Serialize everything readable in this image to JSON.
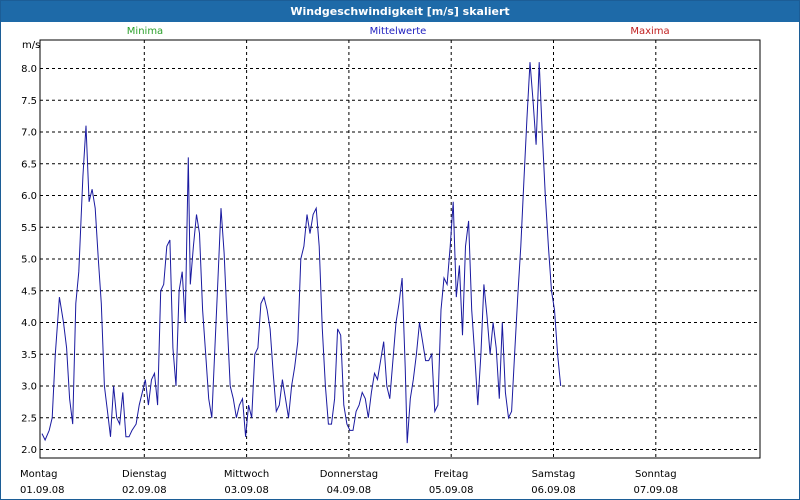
{
  "window": {
    "title": "Windgeschwindigkeit [m/s] skaliert"
  },
  "colors": {
    "minima": "#2aa02a",
    "mittelwerte": "#2020c0",
    "maxima": "#c02020",
    "series_line": "#1a1aa0",
    "titlebar": "#1e6aa8",
    "grid": "#000000"
  },
  "chart_data": {
    "type": "line",
    "title": "Windgeschwindigkeit [m/s] skaliert",
    "ylabel": "m/s",
    "ylim": [
      1.8,
      8.4
    ],
    "yticks": [
      2.0,
      2.5,
      3.0,
      3.5,
      4.0,
      4.5,
      5.0,
      5.5,
      6.0,
      6.5,
      7.0,
      7.5,
      8.0
    ],
    "ytick_labels": [
      "2.0",
      "2.5",
      "3.0",
      "3.5",
      "4.0",
      "4.5",
      "5.0",
      "5.5",
      "6.0",
      "6.5",
      "7.0",
      "7.5",
      "8.0"
    ],
    "xlim": [
      0,
      7
    ],
    "x_unit": "days since 01.09.08 00:00",
    "xticks": [
      {
        "day": "Montag",
        "date": "01.09.08"
      },
      {
        "day": "Dienstag",
        "date": "02.09.08"
      },
      {
        "day": "Mittwoch",
        "date": "03.09.08"
      },
      {
        "day": "Donnerstag",
        "date": "04.09.08"
      },
      {
        "day": "Freitag",
        "date": "05.09.08"
      },
      {
        "day": "Samstag",
        "date": "06.09.08"
      },
      {
        "day": "Sonntag",
        "date": "07.09.08"
      }
    ],
    "legend": [
      "Minima",
      "Mittelwerte",
      "Maxima"
    ],
    "legend_placement": "top",
    "grid": true,
    "series": [
      {
        "name": "Mittelwerte",
        "points": [
          [
            0.0,
            2.25
          ],
          [
            0.03,
            2.15
          ],
          [
            0.07,
            2.3
          ],
          [
            0.1,
            2.5
          ],
          [
            0.13,
            3.5
          ],
          [
            0.17,
            4.4
          ],
          [
            0.21,
            4.0
          ],
          [
            0.24,
            3.6
          ],
          [
            0.27,
            2.8
          ],
          [
            0.3,
            2.4
          ],
          [
            0.33,
            4.3
          ],
          [
            0.36,
            4.8
          ],
          [
            0.4,
            6.3
          ],
          [
            0.43,
            7.1
          ],
          [
            0.46,
            5.9
          ],
          [
            0.49,
            6.1
          ],
          [
            0.52,
            5.8
          ],
          [
            0.55,
            5.0
          ],
          [
            0.58,
            4.3
          ],
          [
            0.61,
            3.0
          ],
          [
            0.64,
            2.6
          ],
          [
            0.67,
            2.2
          ],
          [
            0.7,
            3.0
          ],
          [
            0.73,
            2.5
          ],
          [
            0.76,
            2.4
          ],
          [
            0.79,
            2.9
          ],
          [
            0.82,
            2.2
          ],
          [
            0.85,
            2.2
          ],
          [
            0.88,
            2.3
          ],
          [
            0.92,
            2.4
          ],
          [
            0.95,
            2.7
          ],
          [
            0.98,
            2.9
          ],
          [
            1.01,
            3.1
          ],
          [
            1.04,
            2.7
          ],
          [
            1.07,
            3.1
          ],
          [
            1.1,
            3.2
          ],
          [
            1.13,
            2.7
          ],
          [
            1.16,
            4.5
          ],
          [
            1.19,
            4.6
          ],
          [
            1.22,
            5.2
          ],
          [
            1.25,
            5.3
          ],
          [
            1.28,
            3.6
          ],
          [
            1.31,
            3.0
          ],
          [
            1.34,
            4.5
          ],
          [
            1.37,
            4.8
          ],
          [
            1.4,
            4.0
          ],
          [
            1.43,
            6.6
          ],
          [
            1.45,
            4.6
          ],
          [
            1.48,
            5.2
          ],
          [
            1.51,
            5.7
          ],
          [
            1.54,
            5.4
          ],
          [
            1.57,
            4.2
          ],
          [
            1.6,
            3.5
          ],
          [
            1.63,
            2.8
          ],
          [
            1.66,
            2.5
          ],
          [
            1.69,
            3.6
          ],
          [
            1.72,
            4.7
          ],
          [
            1.75,
            5.8
          ],
          [
            1.78,
            5.1
          ],
          [
            1.81,
            4.0
          ],
          [
            1.84,
            3.0
          ],
          [
            1.87,
            2.8
          ],
          [
            1.9,
            2.5
          ],
          [
            1.93,
            2.7
          ],
          [
            1.96,
            2.8
          ],
          [
            1.99,
            2.2
          ],
          [
            2.02,
            2.7
          ],
          [
            2.05,
            2.5
          ],
          [
            2.08,
            3.5
          ],
          [
            2.11,
            3.6
          ],
          [
            2.14,
            4.3
          ],
          [
            2.17,
            4.4
          ],
          [
            2.2,
            4.2
          ],
          [
            2.23,
            3.9
          ],
          [
            2.26,
            3.2
          ],
          [
            2.29,
            2.6
          ],
          [
            2.32,
            2.7
          ],
          [
            2.35,
            3.1
          ],
          [
            2.38,
            2.8
          ],
          [
            2.41,
            2.5
          ],
          [
            2.44,
            3.0
          ],
          [
            2.47,
            3.3
          ],
          [
            2.5,
            3.7
          ],
          [
            2.53,
            5.0
          ],
          [
            2.56,
            5.2
          ],
          [
            2.59,
            5.7
          ],
          [
            2.62,
            5.4
          ],
          [
            2.65,
            5.7
          ],
          [
            2.68,
            5.8
          ],
          [
            2.71,
            5.2
          ],
          [
            2.74,
            3.9
          ],
          [
            2.77,
            3.0
          ],
          [
            2.8,
            2.4
          ],
          [
            2.83,
            2.4
          ],
          [
            2.86,
            2.8
          ],
          [
            2.89,
            3.9
          ],
          [
            2.92,
            3.8
          ],
          [
            2.95,
            2.7
          ],
          [
            2.98,
            2.4
          ],
          [
            3.01,
            2.3
          ],
          [
            3.04,
            2.3
          ],
          [
            3.07,
            2.6
          ],
          [
            3.1,
            2.7
          ],
          [
            3.13,
            2.9
          ],
          [
            3.16,
            2.8
          ],
          [
            3.19,
            2.5
          ],
          [
            3.22,
            2.9
          ],
          [
            3.25,
            3.2
          ],
          [
            3.28,
            3.1
          ],
          [
            3.31,
            3.4
          ],
          [
            3.34,
            3.7
          ],
          [
            3.37,
            3.0
          ],
          [
            3.4,
            2.8
          ],
          [
            3.43,
            3.4
          ],
          [
            3.46,
            4.0
          ],
          [
            3.49,
            4.3
          ],
          [
            3.52,
            4.7
          ],
          [
            3.55,
            3.3
          ],
          [
            3.57,
            2.1
          ],
          [
            3.6,
            2.8
          ],
          [
            3.63,
            3.1
          ],
          [
            3.66,
            3.5
          ],
          [
            3.69,
            4.0
          ],
          [
            3.72,
            3.7
          ],
          [
            3.75,
            3.4
          ],
          [
            3.78,
            3.4
          ],
          [
            3.81,
            3.5
          ],
          [
            3.84,
            2.6
          ],
          [
            3.87,
            2.7
          ],
          [
            3.9,
            4.2
          ],
          [
            3.93,
            4.7
          ],
          [
            3.96,
            4.6
          ],
          [
            3.99,
            5.2
          ],
          [
            4.02,
            5.9
          ],
          [
            4.05,
            4.4
          ],
          [
            4.08,
            4.9
          ],
          [
            4.11,
            3.8
          ],
          [
            4.14,
            5.2
          ],
          [
            4.17,
            5.6
          ],
          [
            4.2,
            4.2
          ],
          [
            4.23,
            3.5
          ],
          [
            4.26,
            2.7
          ],
          [
            4.29,
            3.5
          ],
          [
            4.32,
            4.6
          ],
          [
            4.35,
            4.1
          ],
          [
            4.38,
            3.5
          ],
          [
            4.41,
            4.0
          ],
          [
            4.44,
            3.6
          ],
          [
            4.47,
            2.8
          ],
          [
            4.5,
            4.0
          ],
          [
            4.53,
            2.9
          ],
          [
            4.56,
            2.5
          ],
          [
            4.59,
            2.6
          ],
          [
            4.62,
            3.5
          ],
          [
            4.65,
            4.4
          ],
          [
            4.68,
            5.2
          ],
          [
            4.71,
            6.2
          ],
          [
            4.74,
            7.2
          ],
          [
            4.77,
            8.1
          ],
          [
            4.8,
            7.5
          ],
          [
            4.83,
            6.8
          ],
          [
            4.86,
            8.1
          ],
          [
            4.89,
            7.0
          ],
          [
            4.92,
            6.0
          ],
          [
            4.95,
            5.2
          ],
          [
            4.98,
            4.5
          ],
          [
            5.01,
            4.2
          ],
          [
            5.04,
            3.5
          ],
          [
            5.07,
            3.0
          ]
        ]
      }
    ]
  }
}
